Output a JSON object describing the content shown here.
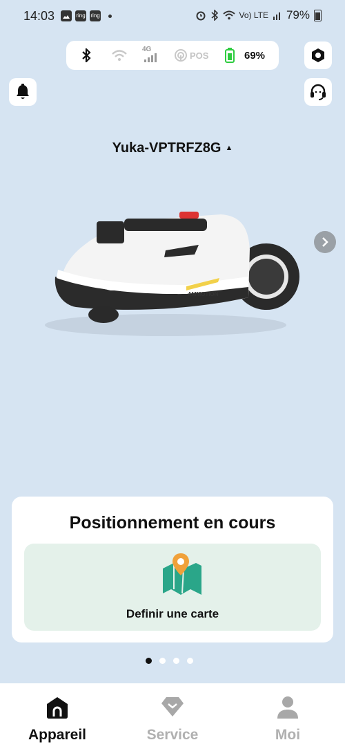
{
  "status_bar": {
    "time": "14:03",
    "notif_icons": [
      "image-icon",
      "ring",
      "ring"
    ],
    "ring_label": "ring",
    "network_label": "Vo) LTE",
    "battery_percent": "79%"
  },
  "connection": {
    "lte_label": "4G",
    "pos_label": "POS",
    "battery_percent": "69%"
  },
  "device": {
    "name": "Yuka-VPTRFZ8G",
    "brand": "AMMOTION"
  },
  "card": {
    "title": "Positionnement en cours",
    "map_action_label": "Definir une carte"
  },
  "pager": {
    "count": 4,
    "active_index": 0
  },
  "tabs": [
    {
      "label": "Appareil",
      "active": true
    },
    {
      "label": "Service",
      "active": false
    },
    {
      "label": "Moi",
      "active": false
    }
  ],
  "colors": {
    "background": "#d6e4f2",
    "battery_green": "#2ecc40",
    "map_pin_orange": "#f0a13a",
    "map_teal": "#2aa689"
  }
}
